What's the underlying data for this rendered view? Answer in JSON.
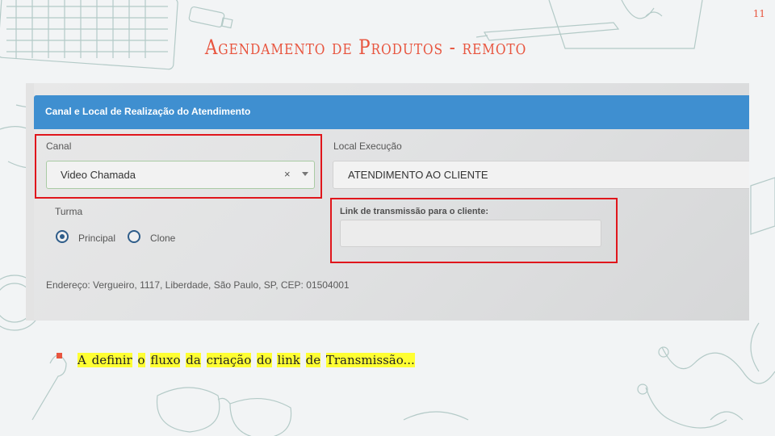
{
  "slide": {
    "page_number": "11",
    "title": "Agendamento de Produtos - remoto"
  },
  "form": {
    "panel_title": "Canal e Local de Realização do Atendimento",
    "canal": {
      "label": "Canal",
      "value": "Video Chamada",
      "clear_glyph": "×"
    },
    "local_execucao": {
      "label": "Local Execução",
      "value": "ATENDIMENTO AO CLIENTE"
    },
    "turma": {
      "label": "Turma",
      "options": [
        {
          "label": "Principal",
          "selected": true
        },
        {
          "label": "Clone",
          "selected": false
        }
      ]
    },
    "link": {
      "label": "Link de transmissão para o cliente:",
      "value": ""
    },
    "address": "Endereço: Vergueiro, 1117, Liberdade, São Paulo, SP, CEP: 01504001"
  },
  "bullets": [
    {
      "words": [
        "A definir",
        "o",
        "fluxo",
        "da",
        "criação",
        "do",
        "link",
        "de",
        "Transmissão..."
      ]
    }
  ],
  "colors": {
    "accent": "#e8553f",
    "panel_header": "#3f8fd0",
    "highlight_border": "#e0161c",
    "text_highlight": "#ffff33"
  }
}
